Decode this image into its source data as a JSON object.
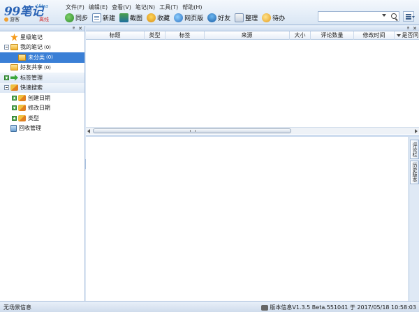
{
  "app": {
    "logo_text": "99笔记",
    "logo_sub": "Ultra",
    "user": "游客",
    "offline": "离线"
  },
  "menu": [
    "文件(F)",
    "编辑(E)",
    "查看(V)",
    "笔记(N)",
    "工具(T)",
    "帮助(H)"
  ],
  "toolbar": [
    {
      "label": "同步",
      "icon": "sync-icon"
    },
    {
      "label": "新建",
      "icon": "new-note-icon"
    },
    {
      "label": "截图",
      "icon": "screenshot-icon"
    },
    {
      "label": "收藏",
      "icon": "favorite-icon"
    },
    {
      "label": "网页版",
      "icon": "web-icon"
    },
    {
      "label": "好友",
      "icon": "friends-icon"
    },
    {
      "label": "整理",
      "icon": "organize-icon"
    },
    {
      "label": "待办",
      "icon": "todo-icon"
    }
  ],
  "search": {
    "value": "",
    "placeholder": ""
  },
  "tree": [
    {
      "label": "星级笔记",
      "count": "",
      "icon": "star-icon",
      "expander": "",
      "indent": 0
    },
    {
      "label": "我的笔记",
      "count": "(0)",
      "icon": "folder-icon",
      "expander": "minus",
      "indent": 0
    },
    {
      "label": "未分类",
      "count": "(0)",
      "icon": "folder-icon",
      "expander": "",
      "indent": 1,
      "selected": true
    },
    {
      "label": "好友共享",
      "count": "(0)",
      "icon": "folder-icon",
      "expander": "",
      "indent": 0
    },
    {
      "label": "标签管理",
      "count": "",
      "icon": "tag-arrow-icon",
      "expander": "plus-green",
      "indent": 0,
      "group": true
    },
    {
      "label": "快速搜索",
      "count": "",
      "icon": "quick-search-icon",
      "expander": "minus",
      "indent": 0,
      "group": true
    },
    {
      "label": "创建日期",
      "count": "",
      "icon": "quick-search-icon",
      "expander": "plus-green",
      "indent": 1
    },
    {
      "label": "修改日期",
      "count": "",
      "icon": "quick-search-icon",
      "expander": "plus-green",
      "indent": 1
    },
    {
      "label": "类型",
      "count": "",
      "icon": "quick-search-icon",
      "expander": "plus-green",
      "indent": 1
    },
    {
      "label": "回收管理",
      "count": "",
      "icon": "recycle-bin-icon",
      "expander": "",
      "indent": 0
    }
  ],
  "columns": [
    "标题",
    "类型",
    "标签",
    "来源",
    "大小",
    "评论数量",
    "修改时间",
    "是否同"
  ],
  "side_tabs": [
    "评论栏",
    "历史版本"
  ],
  "status": {
    "left": "无场景信息",
    "right": "版本信息V1.3.5 Beta.551041 于 2017/05/18 10:58:03"
  }
}
